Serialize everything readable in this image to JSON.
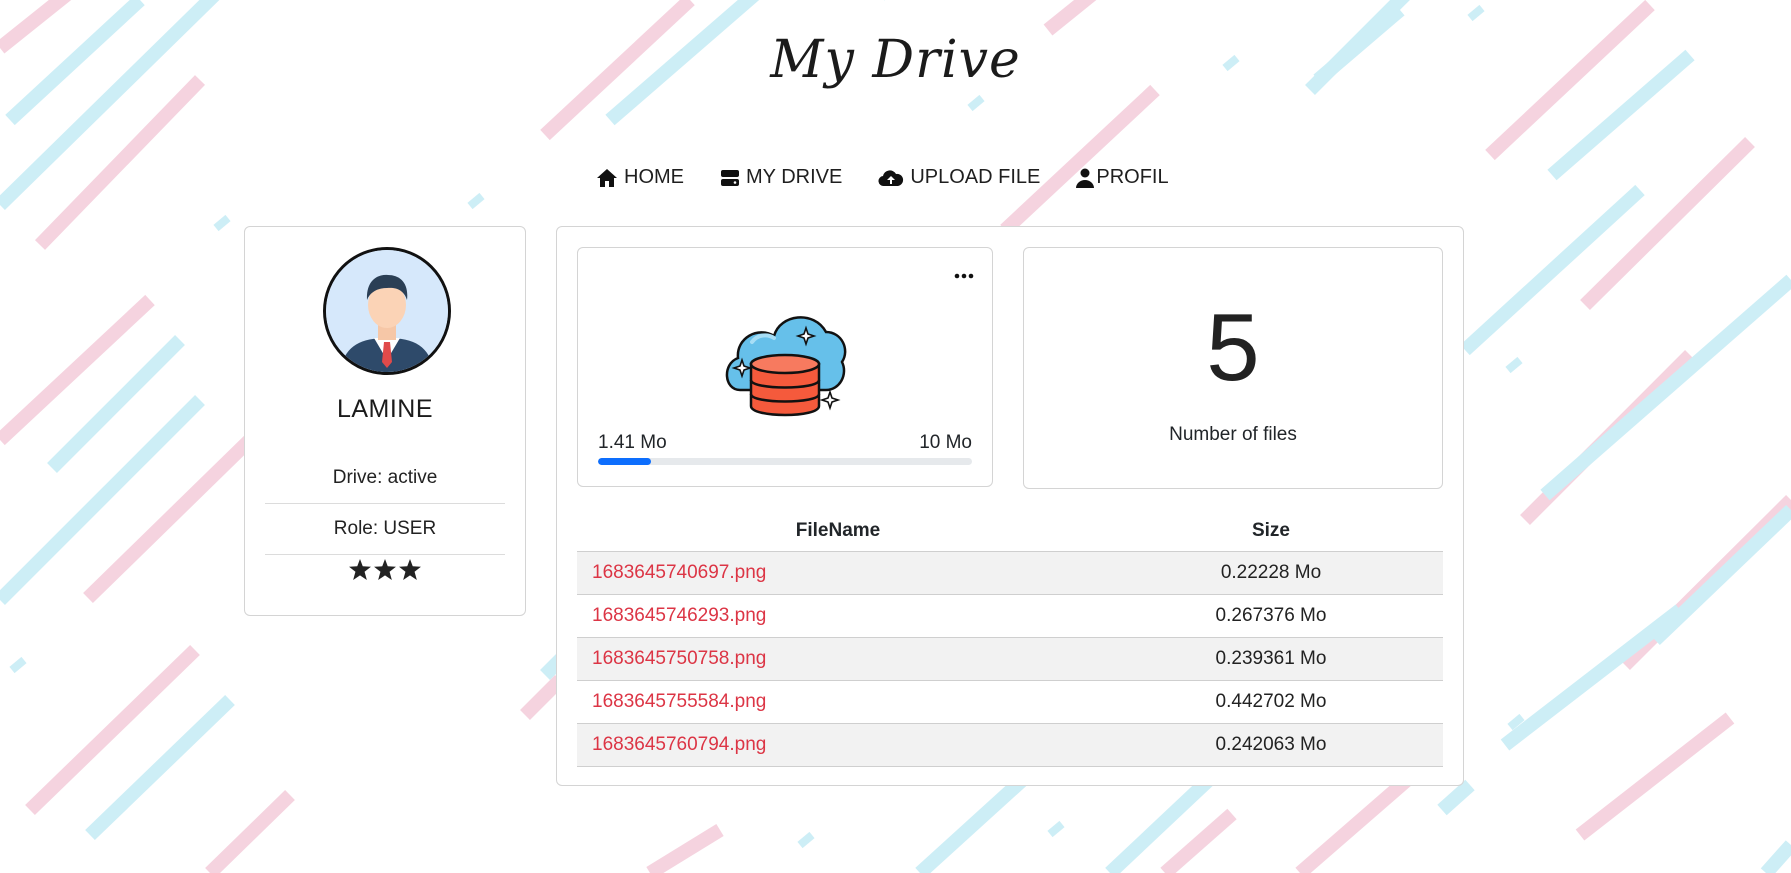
{
  "header": {
    "title": "My Drive"
  },
  "nav": {
    "items": [
      {
        "label": "HOME",
        "icon": "home-icon"
      },
      {
        "label": "MY DRIVE",
        "icon": "drive-icon"
      },
      {
        "label": "UPLOAD FILE",
        "icon": "cloud-upload-icon"
      },
      {
        "label": "PROFIL",
        "icon": "user-icon"
      }
    ]
  },
  "profile": {
    "name": "LAMINE",
    "drive_status": "Drive: active",
    "role": "Role: USER",
    "rating": 3,
    "avatar_icon": "businessman-avatar-icon"
  },
  "storage": {
    "icon": "cloud-database-icon",
    "used_label": "1.41 Mo",
    "total_label": "10 Mo",
    "used_fraction": 0.141,
    "bar_color": "#0d6efd"
  },
  "files_count": {
    "value": "5",
    "label": "Number of files"
  },
  "files_table": {
    "headers": [
      "FileName",
      "Size"
    ],
    "rows": [
      {
        "name": "1683645740697.png",
        "size": "0.22228 Mo"
      },
      {
        "name": "1683645746293.png",
        "size": "0.267376 Mo"
      },
      {
        "name": "1683645750758.png",
        "size": "0.239361 Mo"
      },
      {
        "name": "1683645755584.png",
        "size": "0.442702 Mo"
      },
      {
        "name": "1683645760794.png",
        "size": "0.242063 Mo"
      }
    ],
    "link_color": "#dc3545"
  },
  "theme": {
    "stripe_pink": "#f5d3df",
    "stripe_blue": "#cdeef6"
  }
}
